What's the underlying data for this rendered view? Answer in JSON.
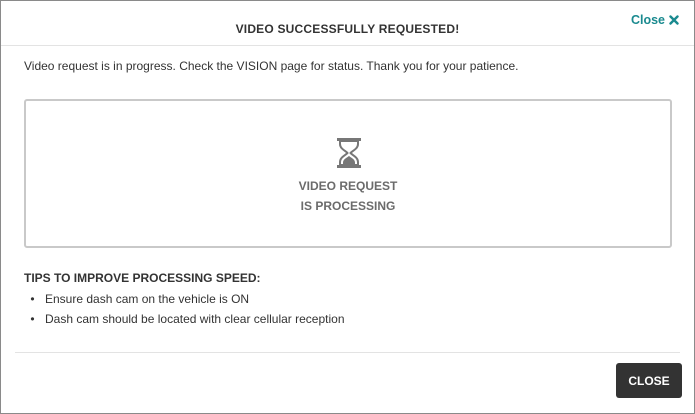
{
  "dialog": {
    "title": "VIDEO SUCCESSFULLY REQUESTED!",
    "close_link_label": "Close",
    "close_icon": "close-x-icon",
    "message": "Video request is in progress. Check the VISION page for status. Thank you for your patience."
  },
  "status": {
    "icon": "hourglass-icon",
    "line1": "VIDEO REQUEST",
    "line2": "IS PROCESSING"
  },
  "tips": {
    "title": "TIPS TO IMPROVE PROCESSING SPEED:",
    "items": [
      "Ensure dash cam on the vehicle is ON",
      "Dash cam should be located with clear cellular reception"
    ]
  },
  "footer": {
    "close_button_label": "CLOSE"
  },
  "colors": {
    "accent_link": "#1a8a8f",
    "button_bg": "#333333",
    "status_text": "#6b6b6b",
    "box_border": "#c9c9c9"
  }
}
